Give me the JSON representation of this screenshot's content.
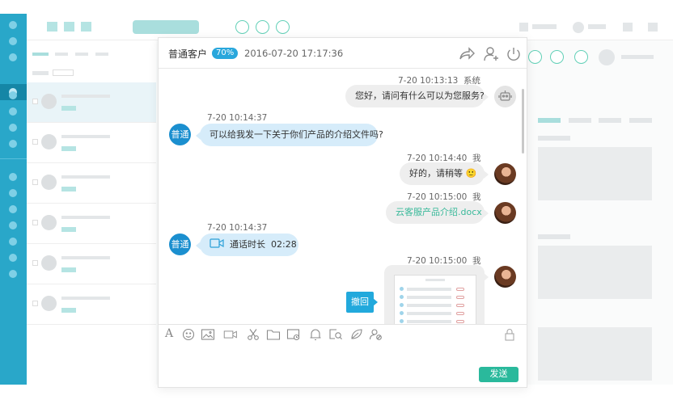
{
  "colors": {
    "rail": "#29a7c9",
    "badge": "#29a7dc",
    "send": "#2ab99c",
    "file_link": "#39b99a",
    "customer_bubble": "#d6ecfa",
    "agent_bubble": "#eeeeee"
  },
  "chat": {
    "header": {
      "customer_type": "普通客户",
      "match_percent": "70%",
      "datetime": "2016-07-20 17:17:36",
      "icons": [
        "share-icon",
        "add-user-icon",
        "power-icon"
      ]
    },
    "messages": [
      {
        "side": "right",
        "time": "7-20  10:13:13",
        "sender": "系统",
        "text": "您好，请问有什么可以为您服务?",
        "avatar": "robot-icon"
      },
      {
        "side": "left",
        "time": "7-20  10:14:37",
        "avatar_label": "普通",
        "text": "可以给我发一下关于你们产品的介绍文件吗?"
      },
      {
        "side": "right",
        "time": "7-20  10:14:40",
        "sender": "我",
        "text": "好的，请稍等",
        "emoji": "🙂"
      },
      {
        "side": "right",
        "time": "7-20  10:15:00",
        "sender": "我",
        "file_name": "云客服产品介绍.docx"
      },
      {
        "side": "left",
        "time": "7-20  10:14:37",
        "avatar_label": "普通",
        "call_label": "通话时长",
        "call_duration": "02:28"
      },
      {
        "side": "right",
        "time": "7-20  10:15:00",
        "sender": "我",
        "image": "screenshot-thumbnail"
      }
    ],
    "recall_label": "撤回",
    "toolbar": [
      "font-icon",
      "emoji-icon",
      "image-icon",
      "video-icon",
      "scissors-icon",
      "folder-icon",
      "screen-record-icon",
      "notify-icon",
      "search-doc-icon",
      "leaf-icon",
      "user-settings-icon",
      "lock-icon"
    ],
    "send_label": "发送"
  }
}
